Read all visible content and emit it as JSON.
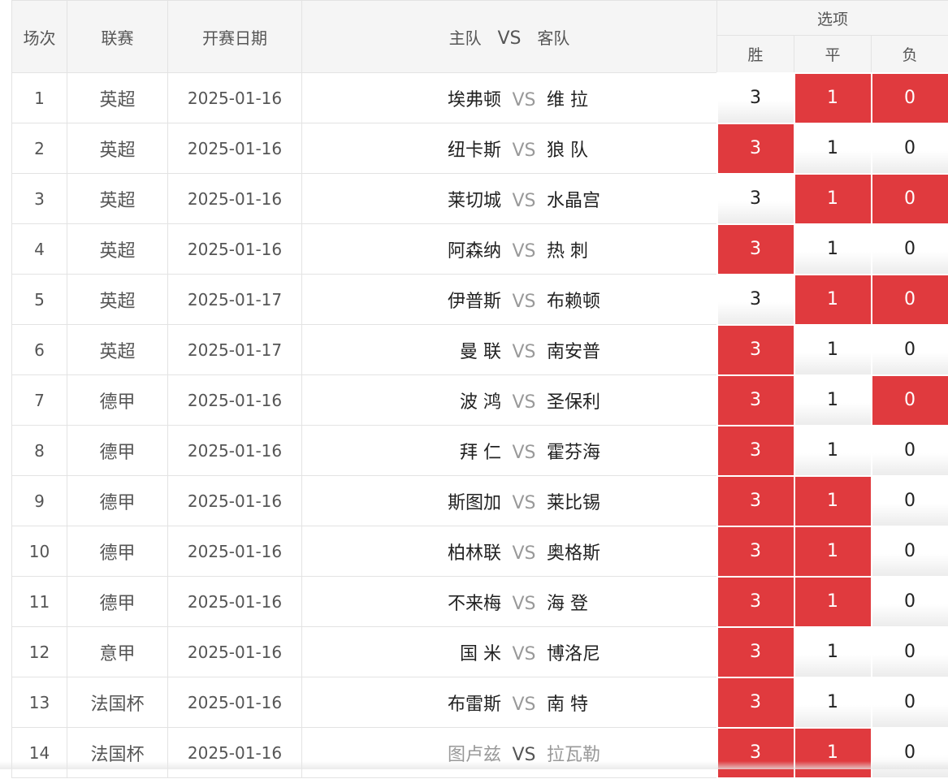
{
  "headers": {
    "no": "场次",
    "league": "联赛",
    "date": "开赛日期",
    "home": "主队",
    "vs": "VS",
    "away": "客队",
    "options": "选项",
    "win": "胜",
    "draw": "平",
    "loss": "负"
  },
  "colors": {
    "selected": "#e03a3e",
    "vs_text": "#999999"
  },
  "rows": [
    {
      "no": "1",
      "league": "英超",
      "date": "2025-01-16",
      "home": "埃弗顿",
      "vs": "VS",
      "away": "维 拉",
      "opts": [
        {
          "label": "3",
          "selected": false
        },
        {
          "label": "1",
          "selected": true
        },
        {
          "label": "0",
          "selected": true
        }
      ]
    },
    {
      "no": "2",
      "league": "英超",
      "date": "2025-01-16",
      "home": "纽卡斯",
      "vs": "VS",
      "away": "狼 队",
      "opts": [
        {
          "label": "3",
          "selected": true
        },
        {
          "label": "1",
          "selected": false
        },
        {
          "label": "0",
          "selected": false
        }
      ]
    },
    {
      "no": "3",
      "league": "英超",
      "date": "2025-01-16",
      "home": "莱切城",
      "vs": "VS",
      "away": "水晶宫",
      "opts": [
        {
          "label": "3",
          "selected": false
        },
        {
          "label": "1",
          "selected": true
        },
        {
          "label": "0",
          "selected": true
        }
      ]
    },
    {
      "no": "4",
      "league": "英超",
      "date": "2025-01-16",
      "home": "阿森纳",
      "vs": "VS",
      "away": "热 刺",
      "opts": [
        {
          "label": "3",
          "selected": true
        },
        {
          "label": "1",
          "selected": false
        },
        {
          "label": "0",
          "selected": false
        }
      ]
    },
    {
      "no": "5",
      "league": "英超",
      "date": "2025-01-17",
      "home": "伊普斯",
      "vs": "VS",
      "away": "布赖顿",
      "opts": [
        {
          "label": "3",
          "selected": false
        },
        {
          "label": "1",
          "selected": true
        },
        {
          "label": "0",
          "selected": true
        }
      ]
    },
    {
      "no": "6",
      "league": "英超",
      "date": "2025-01-17",
      "home": "曼 联",
      "vs": "VS",
      "away": "南安普",
      "opts": [
        {
          "label": "3",
          "selected": true
        },
        {
          "label": "1",
          "selected": false
        },
        {
          "label": "0",
          "selected": false
        }
      ]
    },
    {
      "no": "7",
      "league": "德甲",
      "date": "2025-01-16",
      "home": "波 鸿",
      "vs": "VS",
      "away": "圣保利",
      "opts": [
        {
          "label": "3",
          "selected": true
        },
        {
          "label": "1",
          "selected": false
        },
        {
          "label": "0",
          "selected": true
        }
      ]
    },
    {
      "no": "8",
      "league": "德甲",
      "date": "2025-01-16",
      "home": "拜 仁",
      "vs": "VS",
      "away": "霍芬海",
      "opts": [
        {
          "label": "3",
          "selected": true
        },
        {
          "label": "1",
          "selected": false
        },
        {
          "label": "0",
          "selected": false
        }
      ]
    },
    {
      "no": "9",
      "league": "德甲",
      "date": "2025-01-16",
      "home": "斯图加",
      "vs": "VS",
      "away": "莱比锡",
      "opts": [
        {
          "label": "3",
          "selected": true
        },
        {
          "label": "1",
          "selected": true
        },
        {
          "label": "0",
          "selected": false
        }
      ]
    },
    {
      "no": "10",
      "league": "德甲",
      "date": "2025-01-16",
      "home": "柏林联",
      "vs": "VS",
      "away": "奥格斯",
      "opts": [
        {
          "label": "3",
          "selected": true
        },
        {
          "label": "1",
          "selected": true
        },
        {
          "label": "0",
          "selected": false
        }
      ]
    },
    {
      "no": "11",
      "league": "德甲",
      "date": "2025-01-16",
      "home": "不来梅",
      "vs": "VS",
      "away": "海 登",
      "opts": [
        {
          "label": "3",
          "selected": true
        },
        {
          "label": "1",
          "selected": true
        },
        {
          "label": "0",
          "selected": false
        }
      ]
    },
    {
      "no": "12",
      "league": "意甲",
      "date": "2025-01-16",
      "home": "国 米",
      "vs": "VS",
      "away": "博洛尼",
      "opts": [
        {
          "label": "3",
          "selected": true
        },
        {
          "label": "1",
          "selected": false
        },
        {
          "label": "0",
          "selected": false
        }
      ]
    },
    {
      "no": "13",
      "league": "法国杯",
      "date": "2025-01-16",
      "home": "布雷斯",
      "vs": "VS",
      "away": "南 特",
      "opts": [
        {
          "label": "3",
          "selected": true
        },
        {
          "label": "1",
          "selected": false
        },
        {
          "label": "0",
          "selected": false
        }
      ]
    },
    {
      "no": "14",
      "league": "法国杯",
      "date": "2025-01-16",
      "home": "图卢兹",
      "vs": "VS",
      "away": "拉瓦勒",
      "dimmed": true,
      "opts": [
        {
          "label": "3",
          "selected": true
        },
        {
          "label": "1",
          "selected": true
        },
        {
          "label": "0",
          "selected": false
        }
      ]
    }
  ]
}
